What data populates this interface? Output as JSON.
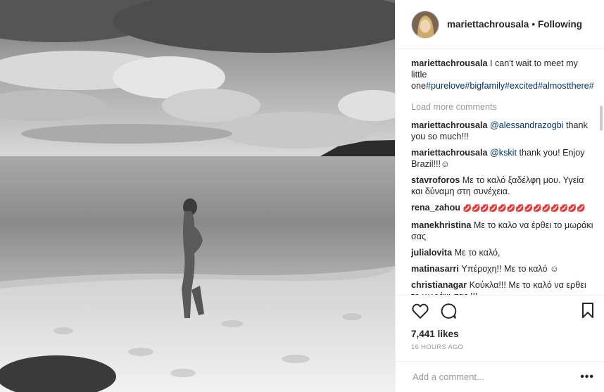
{
  "post": {
    "username": "mariettachrousala",
    "separator": "•",
    "follow_status": "Following",
    "caption_text": "I can't wait to meet my little one",
    "hashtags": [
      "#purelove",
      "#bigfamily",
      "#excited",
      "#almostthere",
      "#"
    ],
    "load_more": "Load more comments",
    "likes": "7,441 likes",
    "time_ago": "16 HOURS AGO",
    "add_comment_placeholder": "Add a comment...",
    "more_options": "•••"
  },
  "comments": [
    {
      "user": "mariettachrousala",
      "mention": "@alessandrazogbi",
      "text": "thank you so much!!!"
    },
    {
      "user": "mariettachrousala",
      "mention": "@kskit",
      "text": "thank you! Enjoy Brazil!!!☺"
    },
    {
      "user": "stavroforos",
      "mention": "",
      "text": "Με το καλό ξαδέλφη μου. Υγεία και δύναμη στη συνέχεια."
    },
    {
      "user": "rena_zahou",
      "mention": "",
      "text": "💋💋💋💋💋💋💋💋💋💋💋💋💋💋"
    },
    {
      "user": "manekhristina",
      "mention": "",
      "text": "Με το καλο να έρθει το μωράκι σας"
    },
    {
      "user": "julialovita",
      "mention": "",
      "text": "Με το καλό,"
    },
    {
      "user": "matinasarri",
      "mention": "",
      "text": "Υπέροχη!! Με το καλό ☺"
    },
    {
      "user": "christianagar",
      "mention": "",
      "text": "Κούκλα!!! Με το καλό να ερθει το μωράκι σας !!!"
    }
  ],
  "icons": {
    "like": "heart-icon",
    "comment": "comment-bubble-icon",
    "save": "bookmark-icon"
  }
}
